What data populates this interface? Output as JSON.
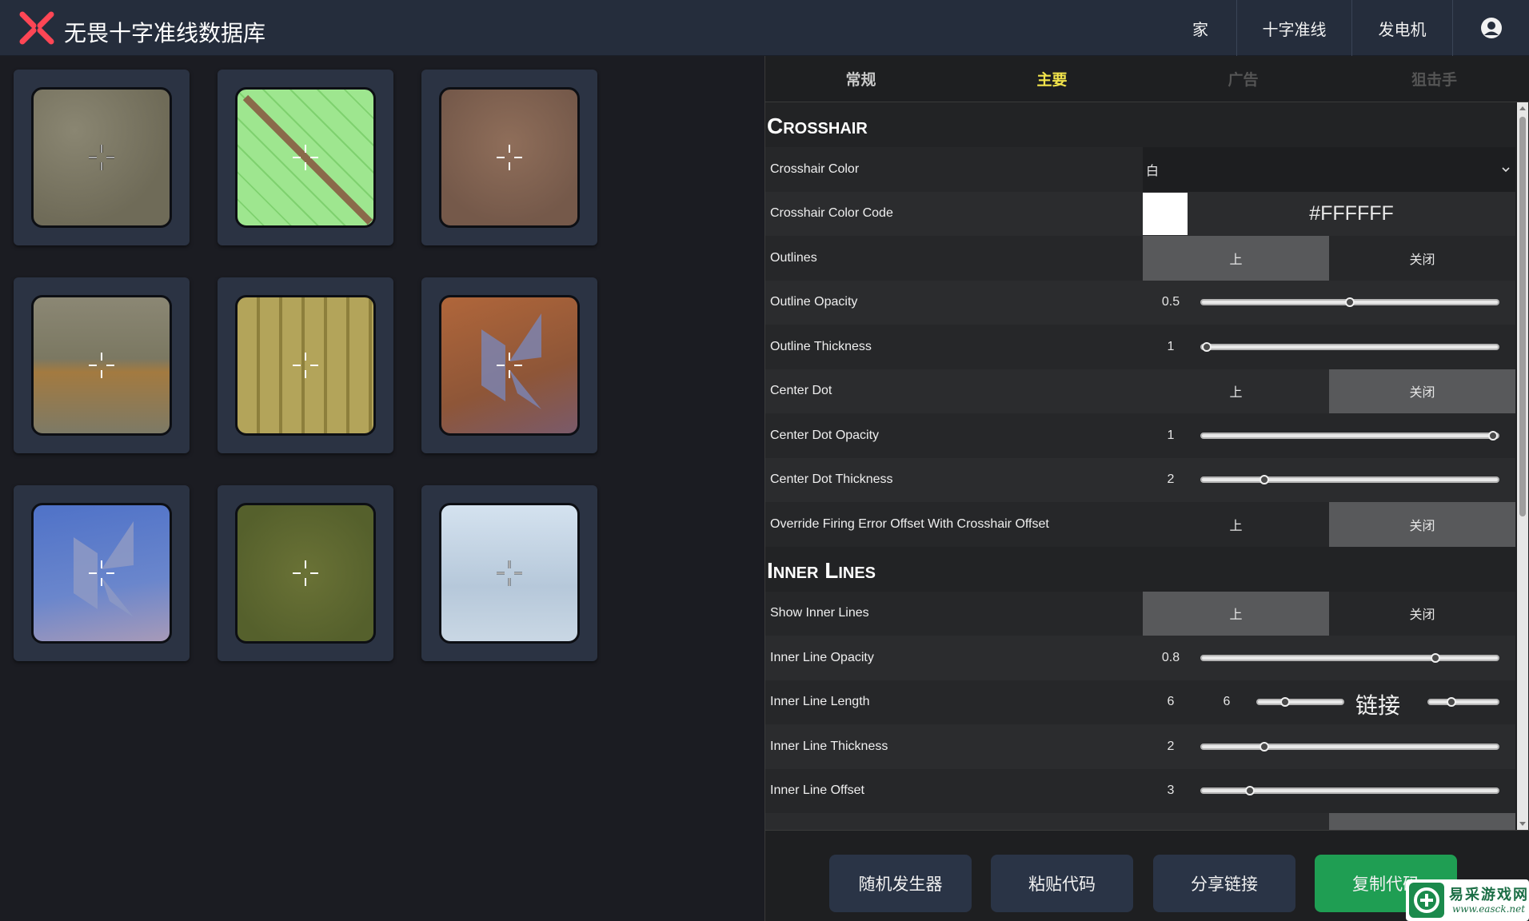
{
  "header": {
    "brand": "无畏十字准线数据库",
    "nav": [
      {
        "label": "家"
      },
      {
        "label": "十字准线"
      },
      {
        "label": "发电机"
      }
    ]
  },
  "tabs": [
    {
      "label": "常规",
      "state": "normal"
    },
    {
      "label": "主要",
      "state": "active"
    },
    {
      "label": "广告",
      "state": "muted"
    },
    {
      "label": "狙击手",
      "state": "muted"
    }
  ],
  "sections": {
    "crosshair": {
      "title": "Crosshair",
      "color": {
        "label": "Crosshair Color",
        "value": "白"
      },
      "color_code": {
        "label": "Crosshair Color Code",
        "value": "#FFFFFF"
      },
      "outlines": {
        "label": "Outlines",
        "on": "上",
        "off": "关闭",
        "selected": "on"
      },
      "outline_opacity": {
        "label": "Outline Opacity",
        "value": "0.5",
        "fraction": 0.5
      },
      "outline_thickness": {
        "label": "Outline Thickness",
        "value": "1",
        "fraction": 0.0
      },
      "center_dot": {
        "label": "Center Dot",
        "on": "上",
        "off": "关闭",
        "selected": "off"
      },
      "center_dot_opacity": {
        "label": "Center Dot Opacity",
        "value": "1",
        "fraction": 1.0
      },
      "center_dot_thickness": {
        "label": "Center Dot Thickness",
        "value": "2",
        "fraction": 0.2
      },
      "override_offset": {
        "label": "Override Firing Error Offset With Crosshair Offset",
        "on": "上",
        "off": "关闭",
        "selected": "off"
      }
    },
    "inner_lines": {
      "title": "Inner Lines",
      "show": {
        "label": "Show Inner Lines",
        "on": "上",
        "off": "关闭",
        "selected": "on"
      },
      "opacity": {
        "label": "Inner Line Opacity",
        "value": "0.8",
        "fraction": 0.8
      },
      "length": {
        "label": "Inner Line Length",
        "value": "6",
        "value2": "6",
        "link_label": "链接",
        "fraction": 0.3,
        "fraction2": 0.3
      },
      "thickness": {
        "label": "Inner Line Thickness",
        "value": "2",
        "fraction": 0.2
      },
      "offset": {
        "label": "Inner Line Offset",
        "value": "3",
        "fraction": 0.15
      }
    }
  },
  "footer": {
    "random": "随机发生器",
    "paste": "粘贴代码",
    "share": "分享链接",
    "copy": "复制代码"
  },
  "watermark": {
    "text": "易采游戏网",
    "url": "www.easck.net"
  },
  "colors": {
    "topbar": "#252d3c",
    "accent_active_tab": "#f2e44b",
    "copy_button": "#1f9e53",
    "tile_frame": "#2b3343"
  }
}
